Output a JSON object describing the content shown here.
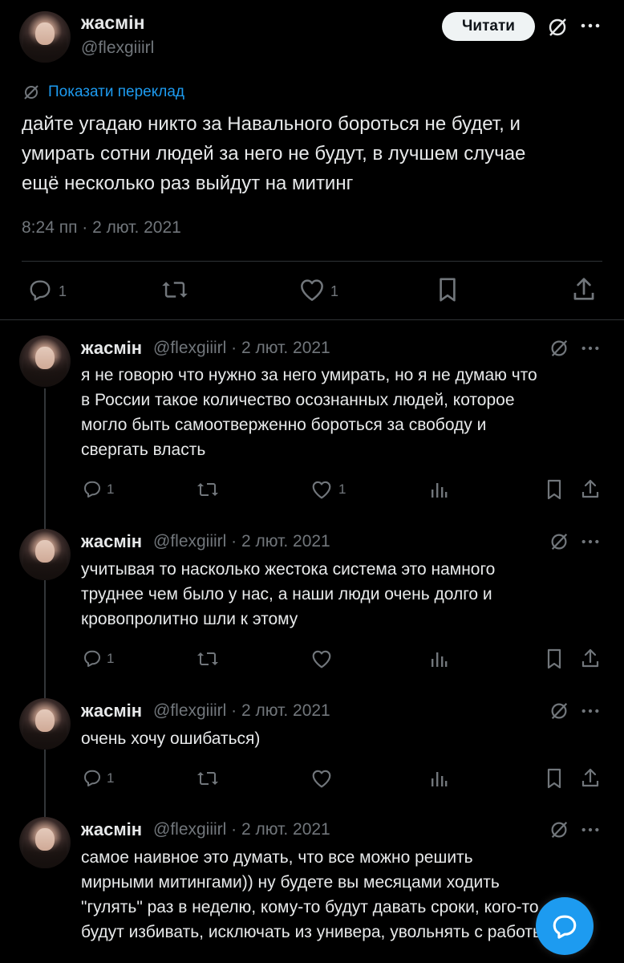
{
  "header": {
    "display_name": "жасмін",
    "handle": "@flexgiiirl",
    "read_button": "Читати"
  },
  "translate_link": "Показати переклад",
  "main_tweet": {
    "lines": [
      "дайте угадаю никто за Навального бороться не будет, и",
      "умирать сотни людей за него не будут, в лучшем случае",
      "ещё несколько раз выйдут на митинг"
    ],
    "timestamp": "8:24 пп · 2 лют. 2021",
    "reply_count": "1",
    "like_count": "1"
  },
  "replies": [
    {
      "name": "жасмін",
      "meta": "@flexgiiirl · 2 лют. 2021",
      "lines": [
        "я не говорю что нужно за него умирать, но я не думаю что",
        "в России такое количество осознанных людей, которое",
        "могло быть самоотверженно бороться за свободу и",
        "свергать власть"
      ],
      "reply_count": "1",
      "like_count": "1"
    },
    {
      "name": "жасмін",
      "meta": "@flexgiiirl · 2 лют. 2021",
      "lines": [
        "учитывая то насколько жестока система это намного",
        "труднее чем было у нас, а наши люди очень долго и",
        "кровопролитно шли к этому"
      ],
      "reply_count": "1",
      "like_count": ""
    },
    {
      "name": "жасмін",
      "meta": "@flexgiiirl · 2 лют. 2021",
      "lines": [
        "очень хочу ошибаться)"
      ],
      "reply_count": "1",
      "like_count": ""
    },
    {
      "name": "жасмін",
      "meta": "@flexgiiirl · 2 лют. 2021",
      "lines": [
        "самое наивное это думать, что все можно решить",
        "мирными митингами)) ну будете вы месяцами ходить",
        "\"гулять\" раз в неделю, кому-то будут давать сроки, кого-то",
        "будут избивать, исключать из универа, увольнять с работы"
      ],
      "reply_count": "",
      "like_count": ""
    }
  ],
  "colors": {
    "background": "#000000",
    "text": "#e7e9ea",
    "muted": "#71767b",
    "link": "#1d9bf0",
    "divider": "#2f3336",
    "fab": "#1d9bf0"
  },
  "icons": [
    "no-translate-icon",
    "more-icon",
    "reply-icon",
    "retweet-icon",
    "like-icon",
    "bookmark-icon",
    "share-icon",
    "views-icon",
    "new-message-icon"
  ]
}
